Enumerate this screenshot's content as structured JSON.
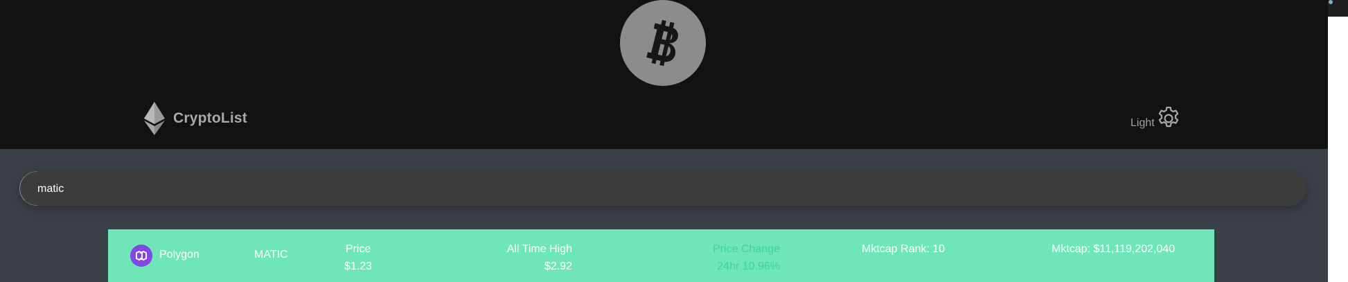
{
  "header": {
    "brand_name": "CryptoList",
    "theme_label": "Light",
    "hero_icon": "bitcoin-icon",
    "logo_icon": "ethereum-icon",
    "settings_icon": "gear-icon"
  },
  "search": {
    "value": "matic"
  },
  "coins": [
    {
      "name": "Polygon",
      "symbol": "MATIC",
      "icon": "polygon-icon",
      "price_label": "Price",
      "price": "$1.23",
      "ath_label": "All Time High",
      "ath": "$2.92",
      "change_label": "Price Change",
      "change": "24hr 10.96%",
      "rank": "Mktcap Rank: 10",
      "mktcap": "Mktcap: $11,119,202,040"
    }
  ],
  "colors": {
    "header_bg": "#121212",
    "content_bg": "#3a3f48",
    "row_bg": "#6ee6b8",
    "positive_change": "#3fd49c",
    "polygon_purple": "#8247e5"
  }
}
